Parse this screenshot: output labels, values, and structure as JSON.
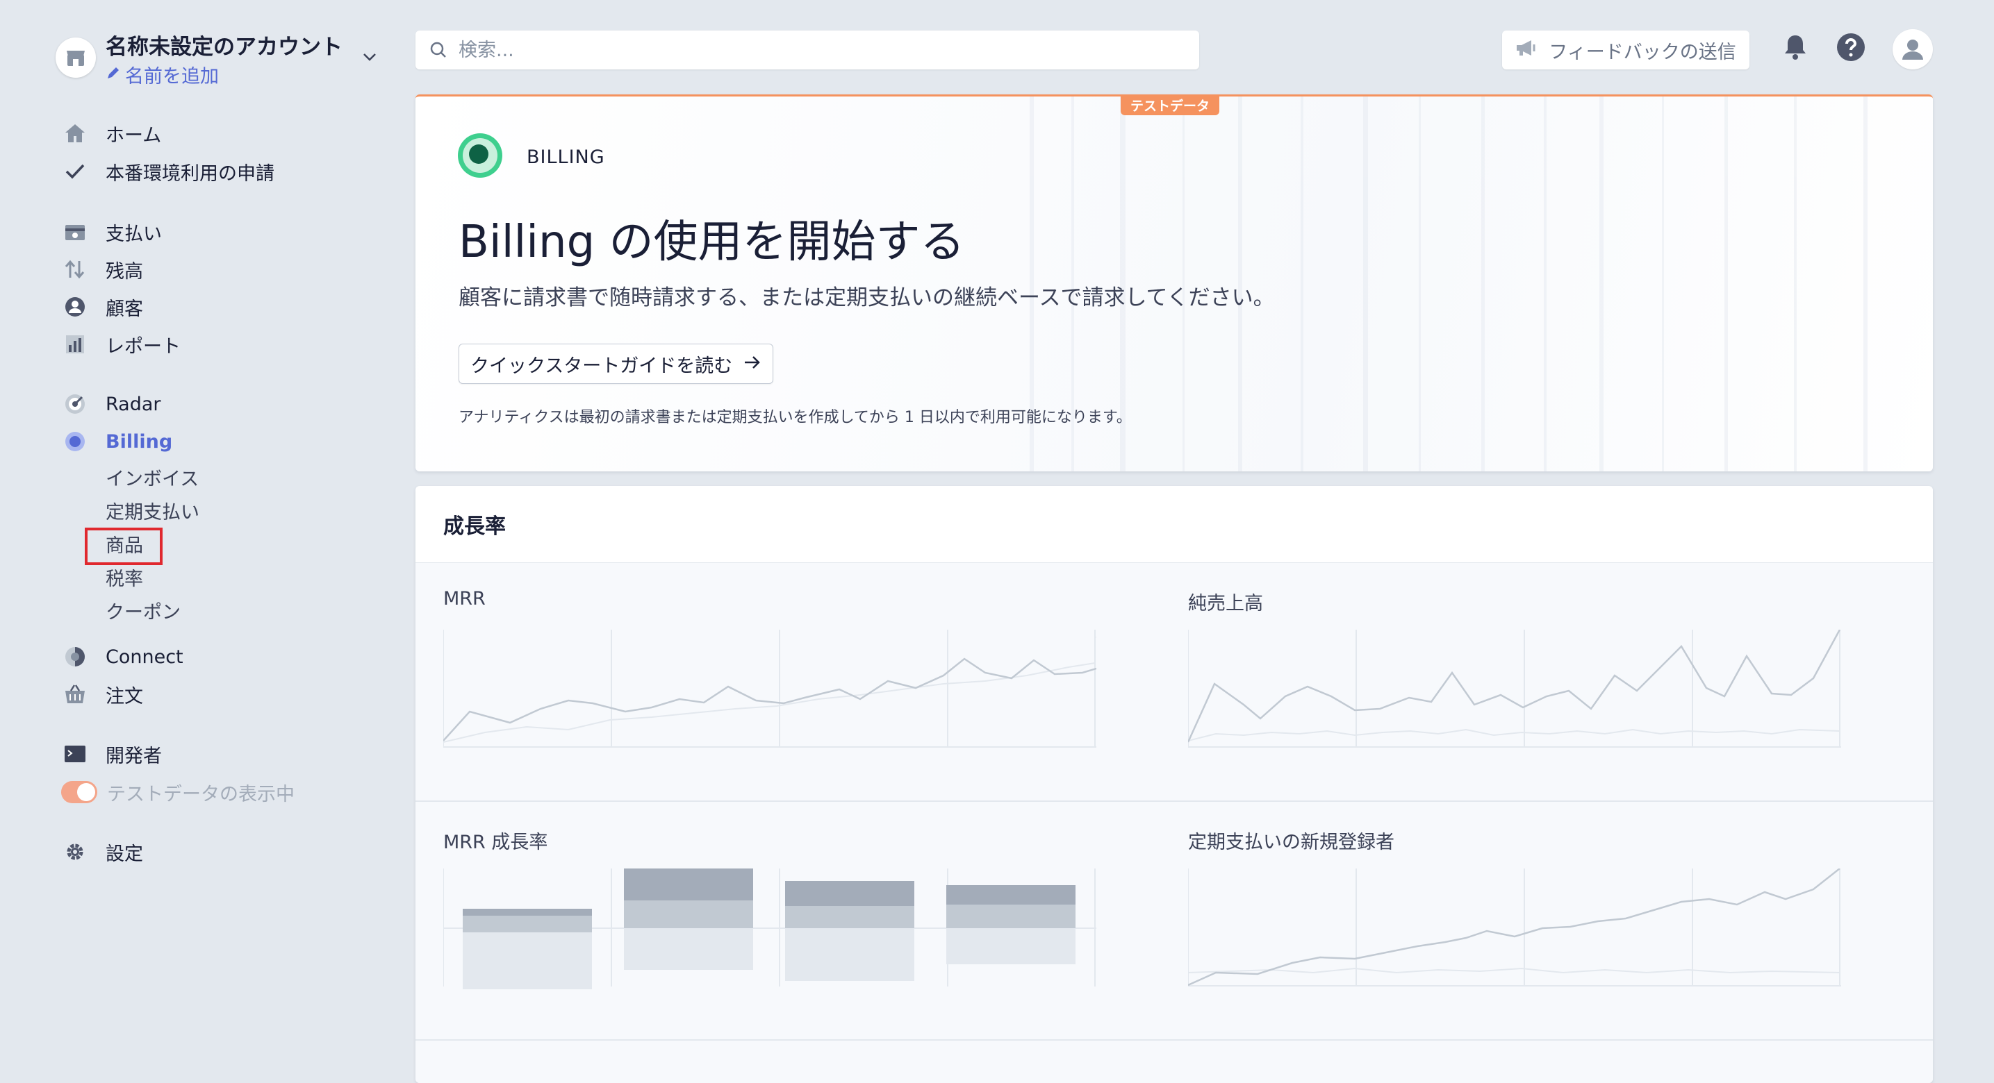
{
  "sidebar": {
    "account_name": "名称未設定のアカウント",
    "add_name": "名前を追加",
    "items": [
      {
        "label": "ホーム",
        "icon": "home-icon"
      },
      {
        "label": "本番環境利用の申請",
        "icon": "check-icon"
      },
      {
        "label": "支払い",
        "icon": "payments-icon"
      },
      {
        "label": "残高",
        "icon": "balance-arrows-icon"
      },
      {
        "label": "顧客",
        "icon": "customer-icon"
      },
      {
        "label": "レポート",
        "icon": "report-icon"
      },
      {
        "label": "Radar",
        "icon": "radar-icon"
      },
      {
        "label": "Billing",
        "icon": "billing-icon"
      },
      {
        "label": "Connect",
        "icon": "connect-icon"
      },
      {
        "label": "注文",
        "icon": "basket-icon"
      },
      {
        "label": "開発者",
        "icon": "terminal-icon"
      },
      {
        "label": "テストデータの表示中",
        "icon": "toggle"
      },
      {
        "label": "設定",
        "icon": "gear-icon"
      }
    ],
    "billing_sub": [
      "インボイス",
      "定期支払い",
      "商品",
      "税率",
      "クーポン"
    ]
  },
  "topbar": {
    "search_placeholder": "検索...",
    "feedback_label": "フィードバックの送信"
  },
  "hero": {
    "badge": "テストデータ",
    "product": "BILLING",
    "title": "Billing の使用を開始する",
    "description": "顧客に請求書で随時請求する、または定期支払いの継続ベースで請求してください。",
    "button": "クイックスタートガイドを読む",
    "note": "アナリティクスは最初の請求書または定期支払いを作成してから 1 日以内で利用可能になります。"
  },
  "growth": {
    "title": "成長率",
    "panels": [
      "MRR",
      "純売上高",
      "MRR 成長率",
      "定期支払いの新規登録者"
    ]
  },
  "colors": {
    "accent": "#5469d4",
    "test_orange": "#f5925e",
    "background": "#e3e8ee"
  }
}
